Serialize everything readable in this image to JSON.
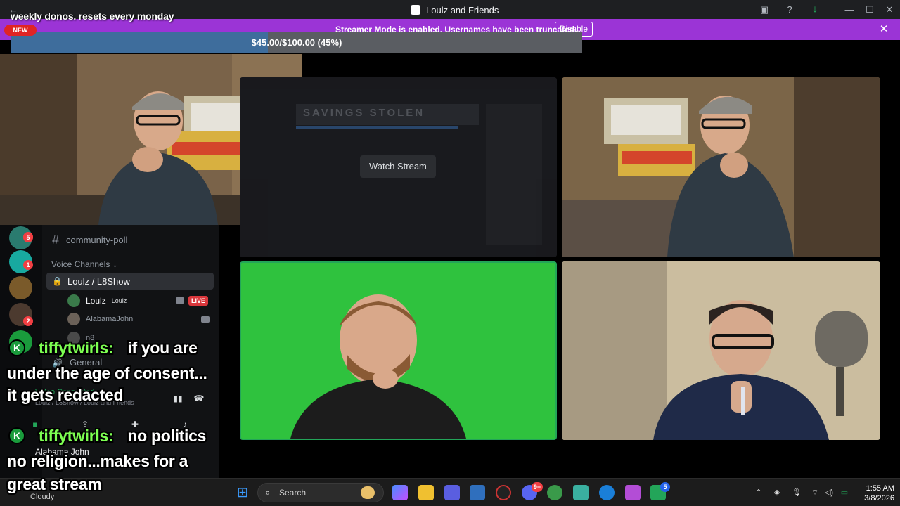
{
  "window": {
    "title": "Loulz and Friends"
  },
  "streamer_banner": {
    "message": "Streamer Mode is enabled. Usernames have been truncated.",
    "disable_label": "Disable",
    "close_icon": "close-icon"
  },
  "donation_overlay": {
    "title": "weekly donos. resets every monday",
    "badge": "NEW",
    "progress_text": "$45.00/$100.00 (45%)",
    "progress_fraction": 0.45
  },
  "stream_tile": {
    "watch_label": "Watch Stream",
    "preview_text": "SAVINGS STOLEN"
  },
  "sidebar": {
    "servers": [
      {
        "badge": "5"
      },
      {
        "badge": "1"
      },
      {
        "badge": ""
      },
      {
        "badge": "2"
      },
      {
        "badge": ""
      }
    ],
    "text_channel": "community-poll",
    "voice_header": "Voice Channels",
    "active_voice": "Loulz / L8Show",
    "voice_users": [
      {
        "name": "Loulz",
        "tag": "Loulz",
        "live": "LIVE"
      },
      {
        "name": "AlabamaJohn"
      },
      {
        "name": "n8"
      }
    ],
    "general_channel": "General",
    "connection_status": "Video Connected",
    "connection_sub": "Loulz / L8Show / Loulz and Friends",
    "footer_user": "Alabama John"
  },
  "chat_overlay": {
    "messages": [
      {
        "user": "tiffytwirls:",
        "line1": "if you are",
        "line2": "under the age of consent...",
        "line3": "it gets redacted"
      },
      {
        "user": "tiffytwirls:",
        "line1": "no politics",
        "line2": "no religion...makes for a",
        "line3": "great stream"
      }
    ]
  },
  "taskbar": {
    "weather": "Cloudy",
    "search_placeholder": "Search",
    "time": "1:55 AM",
    "date": "3/8/2026",
    "discord_badge": "9+",
    "xbox_badge": "5"
  },
  "colors": {
    "streamer_purple": "#9b34d6",
    "live_red": "#da373c",
    "chat_user_green": "#7dff52",
    "progress_blue": "#3e6d9c"
  }
}
